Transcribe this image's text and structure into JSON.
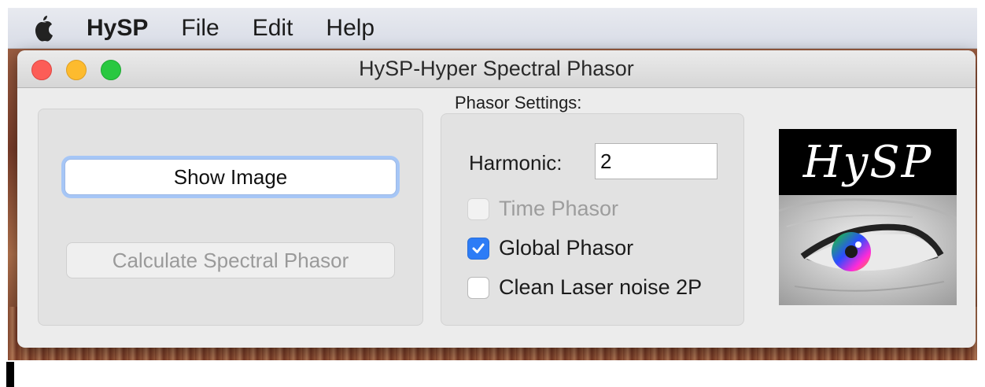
{
  "menubar": {
    "apple_icon": "apple-logo-icon",
    "items": [
      "HySP",
      "File",
      "Edit",
      "Help"
    ]
  },
  "window": {
    "title": "HySP-Hyper Spectral Phasor",
    "controls": [
      "close",
      "minimize",
      "zoom"
    ]
  },
  "left_panel": {
    "show_image_label": "Show Image",
    "calculate_label": "Calculate Spectral Phasor",
    "calculate_enabled": false
  },
  "phasor_settings": {
    "title": "Phasor Settings:",
    "harmonic_label": "Harmonic:",
    "harmonic_value": "2",
    "checkboxes": [
      {
        "label": "Time Phasor",
        "checked": false,
        "enabled": false
      },
      {
        "label": "Global Phasor",
        "checked": true,
        "enabled": true
      },
      {
        "label": "Clean Laser noise 2P",
        "checked": false,
        "enabled": true
      }
    ]
  },
  "logo": {
    "text": "HySP"
  },
  "colors": {
    "accent": "#2d7cf6",
    "focus_ring": "#a6c6f6",
    "close": "#fc5d57",
    "minimize": "#fdbb2e",
    "zoom": "#29c840"
  }
}
